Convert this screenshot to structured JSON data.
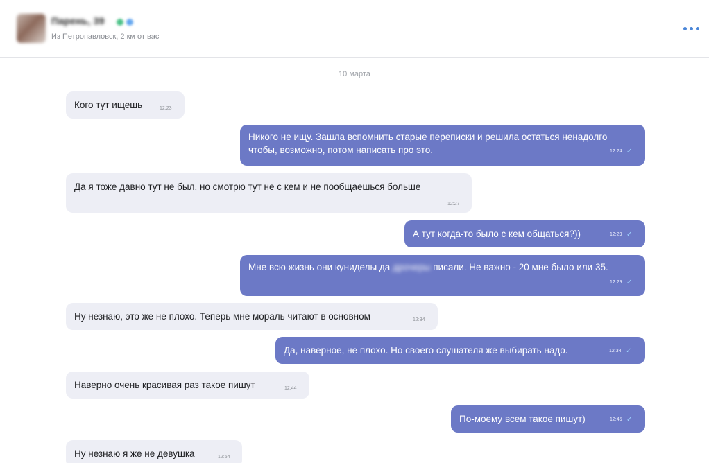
{
  "header": {
    "name": "Парень, 39",
    "subtitle": "Из Петропавловск, 2 км от вас",
    "menu_icon": "more-horizontal-icon",
    "status_colors": [
      "#4fc38a",
      "#66a8f0"
    ]
  },
  "chat": {
    "date": "10 марта",
    "messages": [
      {
        "direction": "incoming",
        "text": "Кого тут ищешь",
        "time": "12:23"
      },
      {
        "direction": "outgoing",
        "text": "Никого не ищу. Зашла вспомнить старые переписки и решила остаться ненадолго чтобы, возможно, потом написать про это.",
        "time": "12:24",
        "read_icon": "check-icon"
      },
      {
        "direction": "incoming",
        "text": "Да я тоже давно тут не был, но смотрю тут не с кем и не пообщаешься больше",
        "time": "12:27"
      },
      {
        "direction": "outgoing",
        "text": "А тут когда-то было с кем общаться?))",
        "time": "12:29",
        "read_icon": "check-icon"
      },
      {
        "direction": "outgoing",
        "text_before_blur": "Мне всю жизнь они куниделы да",
        "blurred_text": "дрочеры",
        "text_after_blur": "писали. Не важно - 20 мне было или 35.",
        "time": "12:29",
        "read_icon": "check-icon"
      },
      {
        "direction": "incoming",
        "text": "Ну незнаю, это же не плохо. Теперь мне мораль читают в основном",
        "time": "12:34"
      },
      {
        "direction": "outgoing",
        "text": "Да, наверное, не плохо. Но своего слушателя же выбирать надо.",
        "time": "12:34",
        "read_icon": "check-icon"
      },
      {
        "direction": "incoming",
        "text": "Наверно очень красивая раз такое пишут",
        "time": "12:44"
      },
      {
        "direction": "outgoing",
        "text": "По-моему всем такое пишут)",
        "time": "12:45",
        "read_icon": "check-icon"
      },
      {
        "direction": "incoming",
        "text": "Ну незнаю я же не девушка",
        "time": "12:54"
      }
    ]
  },
  "colors": {
    "incoming_bubble": "#edeef5",
    "outgoing_bubble": "#6c79c6",
    "accent": "#4a86d8",
    "read_check": "#9fd3ff"
  }
}
